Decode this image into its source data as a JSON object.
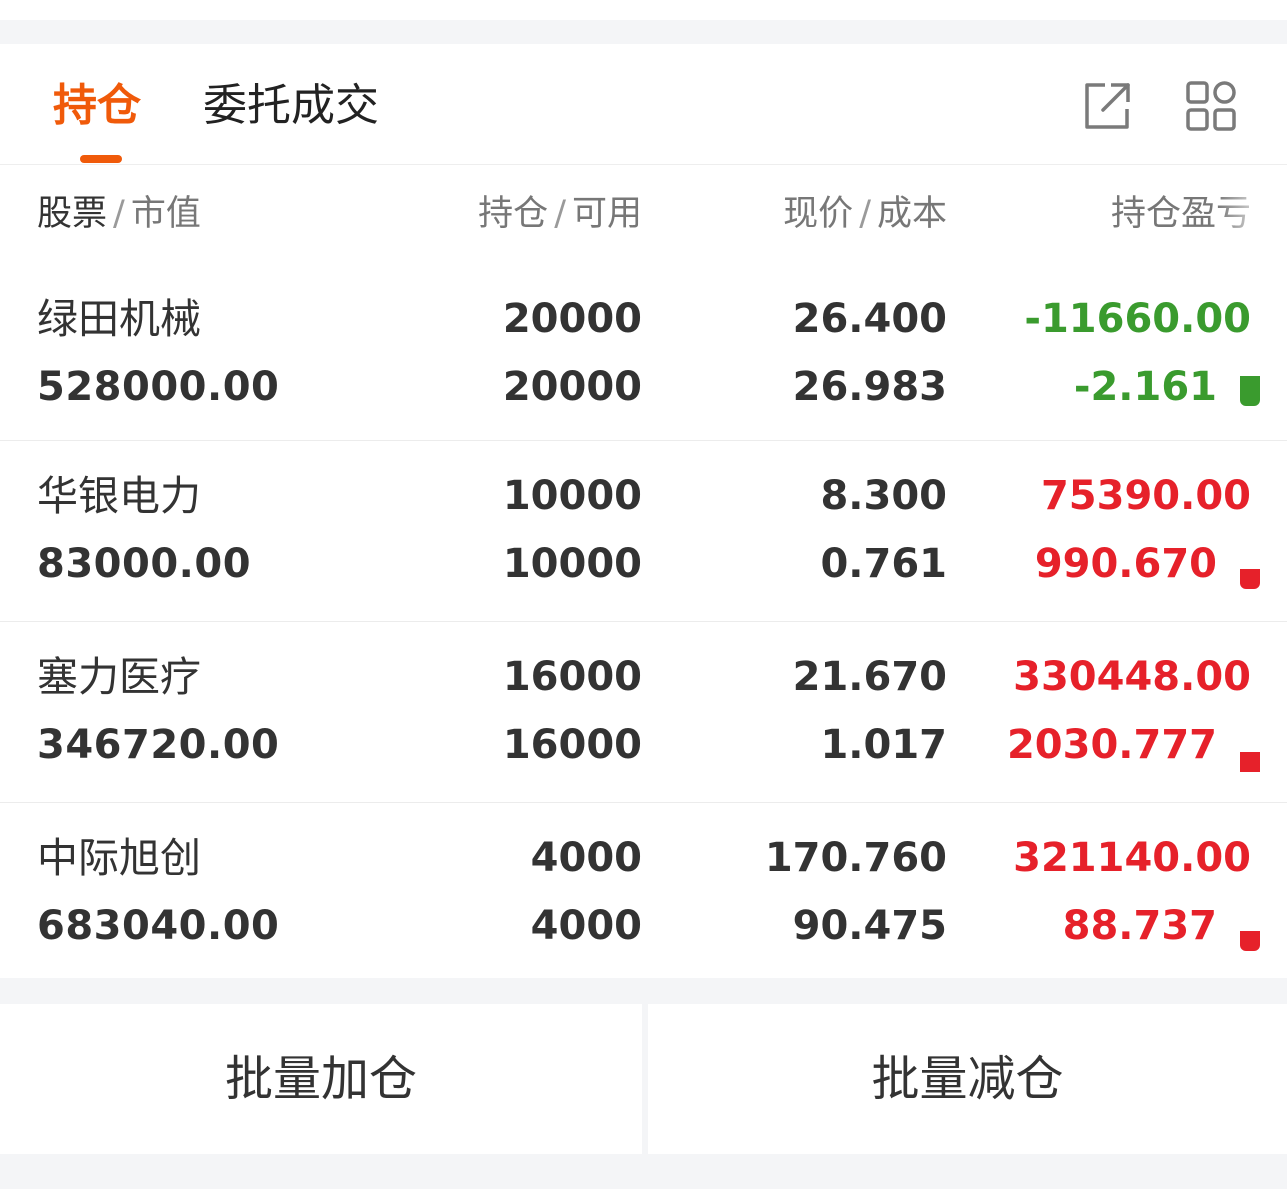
{
  "tabs": {
    "positions": "持仓",
    "orders_trades": "委托成交"
  },
  "toolbar": {
    "export_icon": "external-link-icon",
    "layout_icon": "grid-layout-icon"
  },
  "columns": {
    "stock": "股票",
    "market_value": "市值",
    "holding": "持仓",
    "available": "可用",
    "current_price": "现价",
    "cost": "成本",
    "pnl": "持仓盈亏",
    "sep": "/"
  },
  "holdings": [
    {
      "name": "绿田机械",
      "market_value": "528000.00",
      "holding": "20000",
      "available": "20000",
      "current_price": "26.400",
      "cost": "26.983",
      "pnl": "-11660.00",
      "pnl_pct": "-2.161",
      "trend": "loss"
    },
    {
      "name": "华银电力",
      "market_value": "83000.00",
      "holding": "10000",
      "available": "10000",
      "current_price": "8.300",
      "cost": "0.761",
      "pnl": "75390.00",
      "pnl_pct": "990.670",
      "trend": "gain"
    },
    {
      "name": "塞力医疗",
      "market_value": "346720.00",
      "holding": "16000",
      "available": "16000",
      "current_price": "21.670",
      "cost": "1.017",
      "pnl": "330448.00",
      "pnl_pct": "2030.777",
      "trend": "gain"
    },
    {
      "name": "中际旭创",
      "market_value": "683040.00",
      "holding": "4000",
      "available": "4000",
      "current_price": "170.760",
      "cost": "90.475",
      "pnl": "321140.00",
      "pnl_pct": "88.737",
      "trend": "gain"
    }
  ],
  "actions": {
    "batch_add": "批量加仓",
    "batch_reduce": "批量减仓"
  },
  "colors": {
    "accent": "#f05a0a",
    "gain": "#e6212a",
    "loss": "#3a9b2e"
  }
}
